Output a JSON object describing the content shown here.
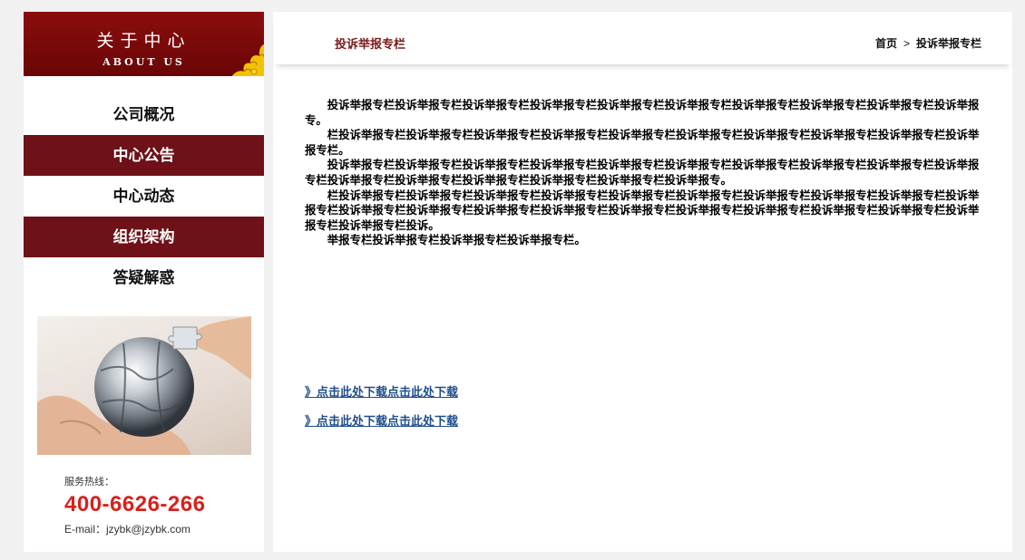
{
  "sidebar": {
    "title": "关于中心",
    "subtitle": "ABOUT US",
    "items": [
      {
        "label": "公司概况",
        "active": false
      },
      {
        "label": "中心公告",
        "active": true
      },
      {
        "label": "中心动态",
        "active": false
      },
      {
        "label": "组织架构",
        "active": true
      },
      {
        "label": "答疑解惑",
        "active": false
      }
    ],
    "hotline_label": "服务热线：",
    "hotline_number": "400-6626-266",
    "email": "E-mail：jzybk@jzybk.com"
  },
  "main": {
    "title": "投诉举报专栏",
    "breadcrumb": {
      "home": "首页",
      "separator": ">",
      "current": "投诉举报专栏"
    },
    "paragraphs": [
      "投诉举报专栏投诉举报专栏投诉举报专栏投诉举报专栏投诉举报专栏投诉举报专栏投诉举报专栏投诉举报专栏投诉举报专栏投诉举报专。",
      "栏投诉举报专栏投诉举报专栏投诉举报专栏投诉举报专栏投诉举报专栏投诉举报专栏投诉举报专栏投诉举报专栏投诉举报专栏投诉举报专栏。",
      "投诉举报专栏投诉举报专栏投诉举报专栏投诉举报专栏投诉举报专栏投诉举报专栏投诉举报专栏投诉举报专栏投诉举报专栏投诉举报专栏投诉举报专栏投诉举报专栏投诉举报专栏投诉举报专栏投诉举报专栏投诉举报专。",
      "栏投诉举报专栏投诉举报专栏投诉举报专栏投诉举报专栏投诉举报专栏投诉举报专栏投诉举报专栏投诉举报专栏投诉举报专栏投诉举报专栏投诉举报专栏投诉举报专栏投诉举报专栏投诉举报专栏投诉举报专栏投诉举报专栏投诉举报专栏投诉举报专栏投诉举报专栏投诉举报专栏投诉举报专栏投诉。",
      "举报专栏投诉举报专栏投诉举报专栏投诉举报专栏。"
    ],
    "downloads": [
      "》点击此处下载点击此处下载",
      "》点击此处下载点击此处下载"
    ]
  },
  "colors": {
    "brand_red": "#6e1118",
    "header_red": "#8b0d0d",
    "hotline_red": "#d8201c",
    "link_blue": "#1f4e8c"
  },
  "icons": {
    "ornament": "cloud-ornament-icon",
    "breadcrumb_separator": "chevron-right-icon",
    "sidebar_image": "globe-puzzle-hand-image"
  }
}
